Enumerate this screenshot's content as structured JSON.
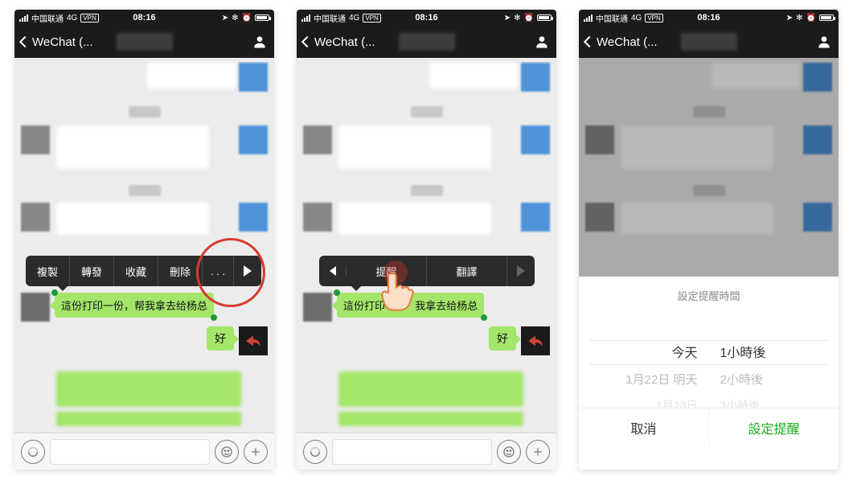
{
  "status": {
    "carrier": "中国联通",
    "network": "4G",
    "vpn": "VPN",
    "time": "08:16"
  },
  "nav": {
    "title": "WeChat (..."
  },
  "menu1": {
    "copy": "複製",
    "forward": "轉發",
    "favorite": "收藏",
    "delete": "刪除",
    "more": ". . ."
  },
  "menu2": {
    "remind": "提醒",
    "translate": "翻譯"
  },
  "msg": {
    "selected": "這份打印一份，帮我拿去给杨总",
    "selected_partA": "這份打印",
    "selected_partB": "我拿去给杨总",
    "reply": "好"
  },
  "sheet": {
    "title": "設定提醒時間",
    "col1_sel": "今天",
    "col2_sel": "1小時後",
    "col1_next": "1月22日 明天",
    "col2_next": "2小時後",
    "cancel": "取消",
    "confirm": "設定提醒"
  }
}
